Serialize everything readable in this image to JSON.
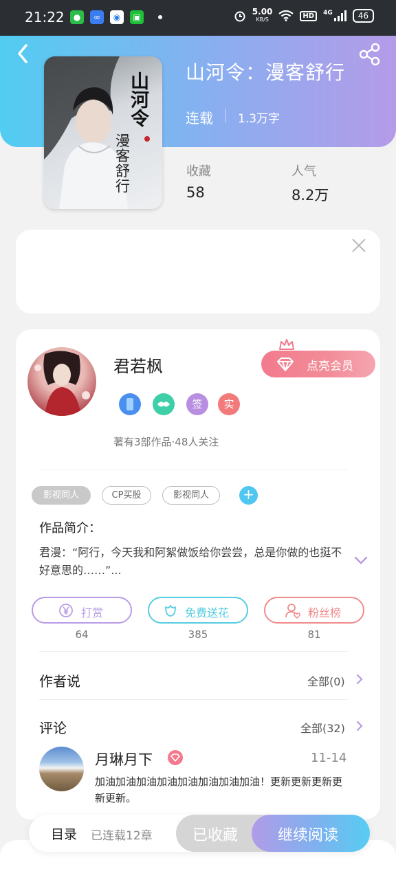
{
  "status_bar": {
    "time": "21:22",
    "net_speed": "5.00",
    "net_unit": "KB/S",
    "hd": "HD",
    "network": "4G",
    "battery": "46"
  },
  "book": {
    "title": "山河令：漫客舒行",
    "status": "连载",
    "word_count": "1.3万字",
    "cover_title": "山河令",
    "cover_subtitle": "漫客舒行",
    "stats": [
      {
        "label": "收藏",
        "value": "58"
      },
      {
        "label": "人气",
        "value": "8.2万"
      }
    ]
  },
  "author": {
    "name": "君若枫",
    "vip_button": "点亮会员",
    "badges": [
      {
        "icon": "phone-badge-icon",
        "text": "",
        "color": "#4a8ff0"
      },
      {
        "icon": "handshake-badge-icon",
        "text": "",
        "color": "#3fcfa8"
      },
      {
        "icon": "sign-badge-icon",
        "text": "签",
        "color": "#b88fe0"
      },
      {
        "icon": "verified-badge-icon",
        "text": "实",
        "color": "#f27a7a"
      }
    ],
    "meta": "著有3部作品·48人关注"
  },
  "tags": [
    "影视同人",
    "CP买股",
    "影视同人"
  ],
  "intro": {
    "label": "作品简介：",
    "text": "君漫：“阿行，今天我和阿絮做饭给你尝尝，总是你做的也挺不好意思的……”..."
  },
  "actions": [
    {
      "label": "打赏",
      "count": "64",
      "color": "#b89be6",
      "icon": "yen-icon"
    },
    {
      "label": "免费送花",
      "count": "385",
      "color": "#54cde0",
      "icon": "flower-icon"
    },
    {
      "label": "粉丝榜",
      "count": "81",
      "color": "#f08a8a",
      "icon": "fan-icon"
    }
  ],
  "author_says": {
    "title": "作者说",
    "more": "全部(0)"
  },
  "comments": {
    "title": "评论",
    "more": "全部(32)",
    "first": {
      "user": "月琳月下",
      "date": "11-14",
      "text": "加油加油加油加油加油加油加油加油！更新更新更新更新更新。"
    }
  },
  "bottom_bar": {
    "toc": "目录",
    "chapters": "已连载12章",
    "collected": "已收藏",
    "continue": "继续阅读"
  }
}
